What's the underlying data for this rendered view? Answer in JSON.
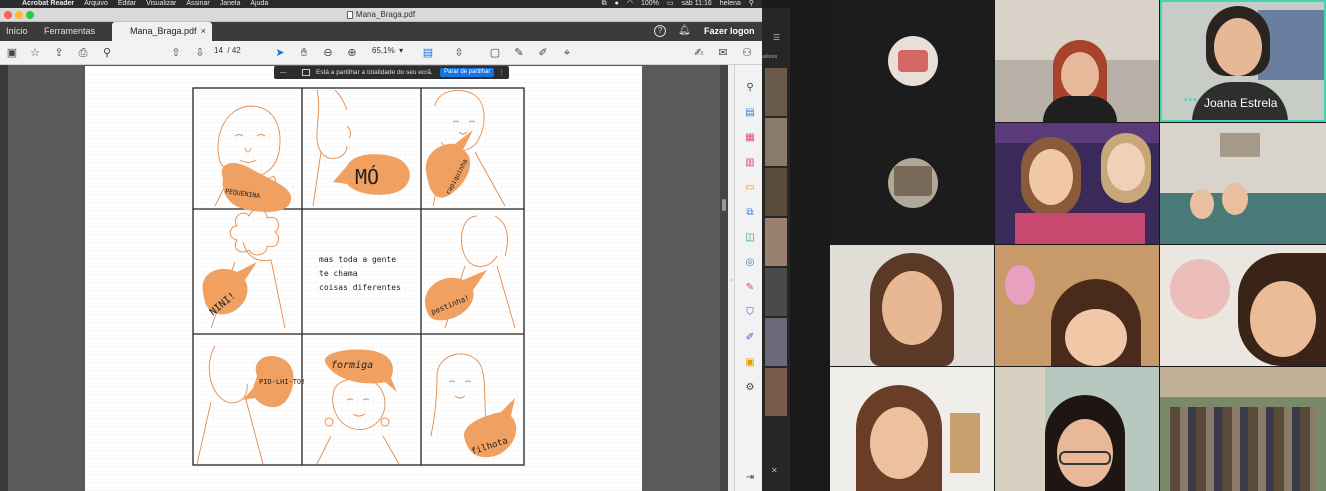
{
  "menubar": {
    "app": "Acrobat Reader",
    "items": [
      "Arquivo",
      "Editar",
      "Visualizar",
      "Assinar",
      "Janela",
      "Ajuda"
    ],
    "battery": "100%",
    "clock": "sáb 11:16",
    "user": "helena"
  },
  "window": {
    "title": "Mana_Braga.pdf"
  },
  "tabs": {
    "home": "Início",
    "tools": "Ferramentas",
    "doc": "Mana_Braga.pdf",
    "close": "×"
  },
  "header": {
    "help": "?",
    "login": "Fazer logon"
  },
  "toolbar": {
    "page_current": "14",
    "page_sep": "/",
    "page_total": "42",
    "zoom": "65,1%"
  },
  "sharebar": {
    "message": "Está a partilhar a totalidade do seu ecrã.",
    "stop": "Parar de partilhar",
    "minus": "—",
    "dots": "⋮"
  },
  "comic": {
    "bubbles": [
      "PEQUENINA",
      "MÓ",
      "rapiquinha",
      "NINI!",
      "pestinha!",
      "PIO-LHI-TO!",
      "formiga",
      "filhota"
    ],
    "caption": [
      "mas toda a gente",
      "te chama",
      "coisas diferentes"
    ]
  },
  "zoom": {
    "strip_label": "adores",
    "speaker_name": "Joana Estrela"
  },
  "colors": {
    "accent": "#1473e6",
    "comic_orange": "#f0a060",
    "speaker_border": "#3fd6b0"
  }
}
